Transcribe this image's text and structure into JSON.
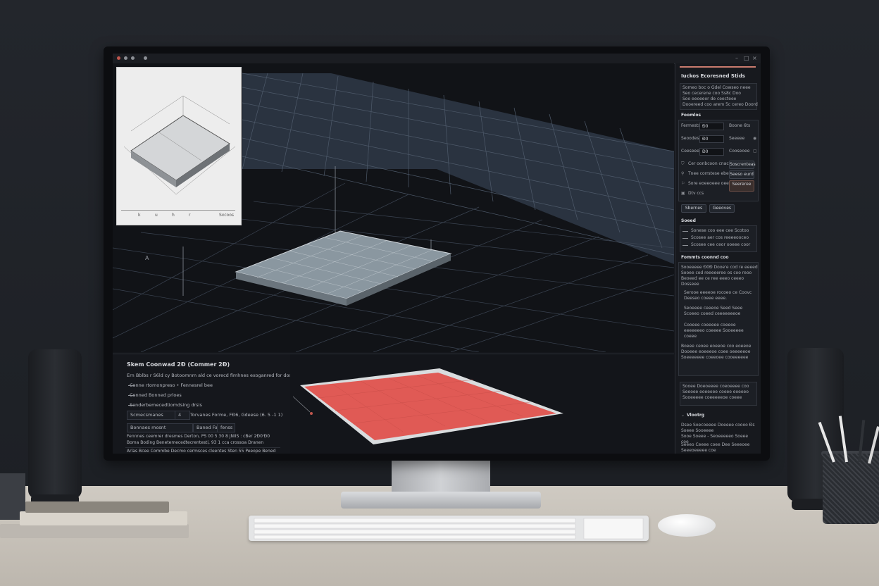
{
  "app": {
    "window_title": ""
  },
  "viewport": {
    "axis_label": "A",
    "inset": {
      "ticks": [
        "k",
        "u",
        "h",
        "r"
      ],
      "label": "Sxcoos"
    }
  },
  "bottom_panel": {
    "title": "Skem Coonwad 2Ð (Commer 2Ð)",
    "description": "Ern Bblbs r S6ld cy Botoomnm ald ce vorecd fimhnes exoganred for dosty",
    "bullets": [
      "Conne rtomonpreso • Fennesrel bee",
      "Conned Bonned prloes",
      "Senderbemecedtiomdsing drsis"
    ],
    "row1_label": "Scmecsmanes",
    "row1_value": "4",
    "row1_text": "Torvanes Forme, FÐ6, Gdeese (6. 5 -1 1)",
    "buttons": [
      "Bonnaes mosnt",
      "Baned Fae",
      "fenss"
    ],
    "line1": "Fennnes ceemrer dresmes Derton, PS 00 5 30 8 JNIIS : cBer 2Ð0'Ð0",
    "line2": "Boma Boding Benetemecedtecrentesti, 93 1 cca crossoa Dranen",
    "footer": "Arlas Bcee Commbe Decmo cermsces cleentes Sten 55 Peeope Bened"
  },
  "sidebar": {
    "title": "Iuckos Ecoresned Stids",
    "intro_lines": [
      "Someo boc o Gdel Cowseo neee",
      "Seo cecerene coo Ss8c Doo",
      "Soo eeoeeor de ceecteee",
      "Dooereed coo arem 5c cereo Doord"
    ],
    "section1": "Foomlos",
    "fields": [
      {
        "label": "Fermests",
        "value": "Ð0",
        "right": "Boone 6ts"
      },
      {
        "label": "Seoodes",
        "value": "Ð0",
        "right": "Seeeee"
      },
      {
        "label": "Ceeseeee",
        "value": "Ð0",
        "right": "Cooseoee"
      }
    ],
    "options": [
      {
        "icon": "⛉",
        "label": "Cer oonbcoon cnac",
        "tag": "Soscrenteas"
      },
      {
        "icon": "⚲",
        "label": "Tnee corrstese ebe",
        "tag": "Seeso eurd"
      },
      {
        "icon": "⚐",
        "label": "Sore eoeeoeee oeee",
        "tag": "Seereree"
      },
      {
        "icon": "▣",
        "label": "Dtv ccs",
        "tag": ""
      }
    ],
    "buttons": [
      "Sbernes",
      "Geeoves"
    ],
    "section2": "Soeed",
    "legend": [
      "Sonese coo eee cee Scotoo",
      "Scosee aer cos reeeeooceo",
      "Scosee cee ceor ooeee coor"
    ],
    "section3": "Fommts coonnd coo",
    "paragraph": [
      "Sooeeeee Ð0Ð Dooe'e cod re eeeed",
      "Sooee cod reeeeeree os coo reoo",
      "Beoeed ee ce ree eeeo ceeeo",
      "Dosseee"
    ],
    "bullets": [
      "Serooe eeeeoe rocoeo ce Coovc Deeseo coeee eeee.",
      "Seoeeee ceeeoe Seed Seee Scoeeo coeed ceeeeeeeoe",
      "Cooeee coeeeee coeeoe eeeeeeeo coeeee Sooeeeee coeee"
    ],
    "paragraph2": [
      "Boeee ceoee eoeeoe coo eoeeoe",
      "Dooeee eoeeeoe coee oeeeeeoe",
      "Soeeeeeee coeeoee cooeeeeee"
    ],
    "note_box": [
      "Sooee Doeoeeee coeoeeee coo",
      "Seeoee eoeeoee coeee eoeeeo",
      "Sooeeeee coeeeeeoe coeee"
    ],
    "section4": "Vlootrg",
    "footer_items": [
      "Dsee Soecoeeee Doeeee coooo Ðs Soeee Sooeeee",
      "Sooe Soeee - Seoeeeeeo Soeee coe",
      "Seeeo Ceeee coee Dee Seeeoee Seeeoeeeee coe"
    ]
  },
  "colors": {
    "accent": "#c97b6e",
    "screen_bg": "#14161b",
    "grid_line": "#4a5568",
    "slab": "#7e8a94",
    "plan_fill": "#e05a55"
  }
}
